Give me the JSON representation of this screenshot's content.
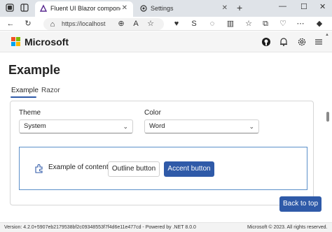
{
  "browser": {
    "tabs": [
      {
        "label": "Fluent UI Blazor components demo",
        "active": true
      },
      {
        "label": "Settings",
        "active": false
      }
    ],
    "address": {
      "url": "https://localhost"
    }
  },
  "site": {
    "brand": "Microsoft"
  },
  "page": {
    "title": "Example",
    "tabs": [
      {
        "label": "Example"
      },
      {
        "label": "Razor"
      }
    ]
  },
  "form": {
    "theme": {
      "label": "Theme",
      "value": "System"
    },
    "color": {
      "label": "Color",
      "value": "Word"
    }
  },
  "demo": {
    "content_text": "Example of content",
    "outline_button": "Outline button",
    "accent_button": "Accent button"
  },
  "back_to_top": "Back to top",
  "footer": {
    "version": "Version: 4.2.0+5907eb2179538bf2c09348553f7f4d6e11e477cd  -  Powered by .NET 8.0.0",
    "copyright": "Microsoft © 2023. All rights reserved."
  },
  "colors": {
    "accent": "#2f5aa8",
    "ms_red": "#f25022",
    "ms_green": "#7fba00",
    "ms_blue": "#00a4ef",
    "ms_yellow": "#ffb900"
  }
}
